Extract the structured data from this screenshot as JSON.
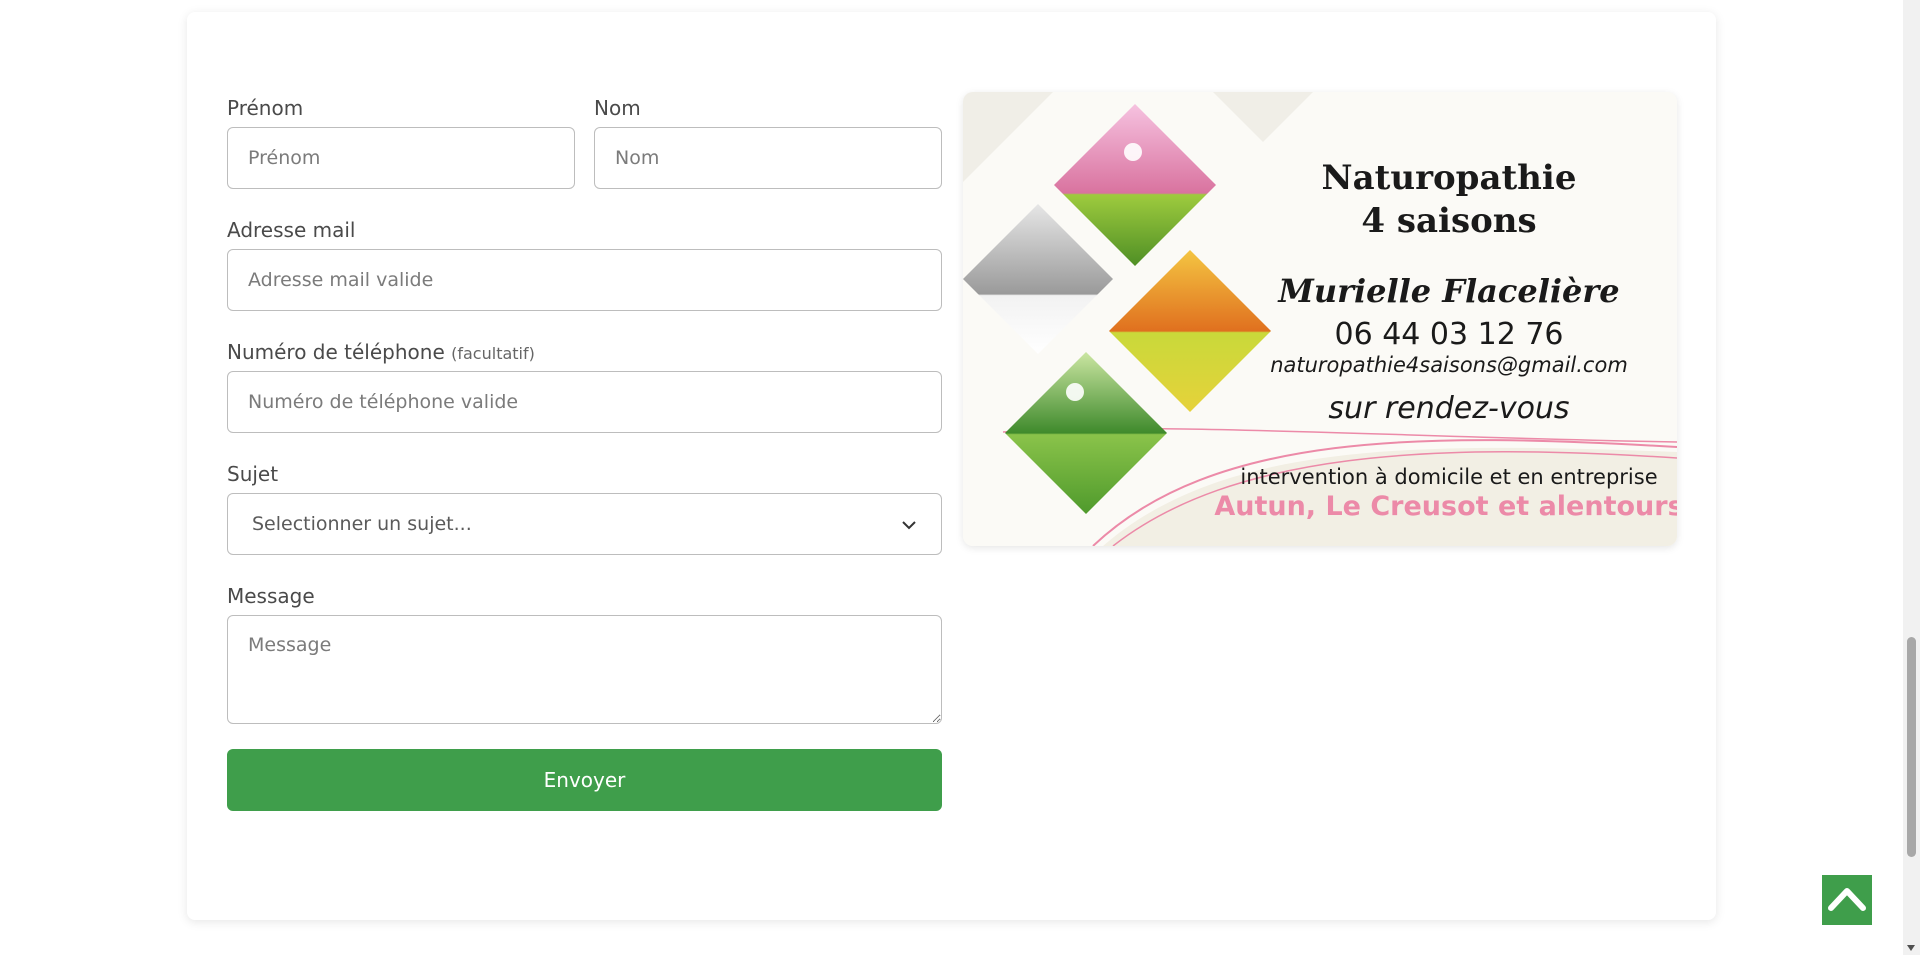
{
  "form": {
    "prenom_label": "Prénom",
    "prenom_placeholder": "Prénom",
    "nom_label": "Nom",
    "nom_placeholder": "Nom",
    "email_label": "Adresse mail",
    "email_placeholder": "Adresse mail valide",
    "phone_label": "Numéro de téléphone",
    "phone_optional": "(facultatif)",
    "phone_placeholder": "Numéro de téléphone valide",
    "subject_label": "Sujet",
    "subject_selected": "Selectionner un sujet...",
    "message_label": "Message",
    "message_placeholder": "Message",
    "submit_label": "Envoyer"
  },
  "banner": {
    "title_line1": "Naturopathie",
    "title_line2": "4 saisons",
    "name": "Murielle Flacelière",
    "phone": "06 44 03 12 76",
    "email": "naturopathie4saisons@gmail.com",
    "appointment": "sur rendez-vous",
    "service": "intervention à domicile et en entreprise",
    "area": "Autun, Le Creusot et alentours"
  },
  "colors": {
    "accent": "#3f9e4b",
    "banner_pink": "#ec8aa8"
  },
  "icons": {
    "scroll_top": "chevron-up-icon",
    "select": "chevron-down-icon"
  }
}
